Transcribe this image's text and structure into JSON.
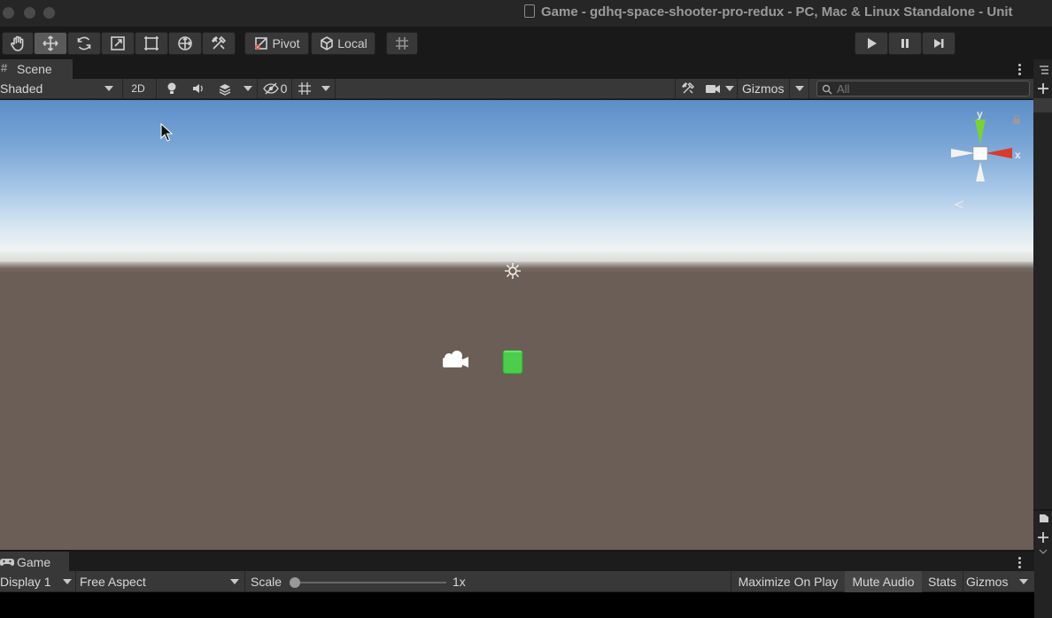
{
  "window": {
    "title": "Game - gdhq-space-shooter-pro-redux - PC, Mac & Linux Standalone - Unit"
  },
  "toolbar": {
    "pivot_label": "Pivot",
    "local_label": "Local",
    "tools": [
      "hand-tool-icon",
      "move-tool-icon",
      "rotate-tool-icon",
      "scale-tool-icon",
      "rect-tool-icon",
      "transform-tool-icon",
      "custom-tool-icon"
    ],
    "play_controls": [
      "play-icon",
      "pause-icon",
      "step-icon"
    ]
  },
  "scene": {
    "tab_label": "Scene",
    "shading_mode": "Shaded",
    "toggle_2d": "2D",
    "hidden_count": "0",
    "gizmos_label": "Gizmos",
    "search_placeholder": "All",
    "axis_x": "x",
    "axis_y": "y",
    "colors": {
      "sky_top": "#5b8ec8",
      "horizon": "#f0f3f3",
      "ground": "#6b5e57",
      "cube": "#4ccd4c",
      "x_axis": "#d93a2b",
      "y_axis": "#7ad13a"
    }
  },
  "game": {
    "tab_label": "Game",
    "display": "Display 1",
    "aspect": "Free Aspect",
    "scale_label": "Scale",
    "scale_value": "1x",
    "scale_fraction": 0,
    "maximize_label": "Maximize On Play",
    "mute_label": "Mute Audio",
    "stats_label": "Stats",
    "gizmos_label": "Gizmos"
  }
}
